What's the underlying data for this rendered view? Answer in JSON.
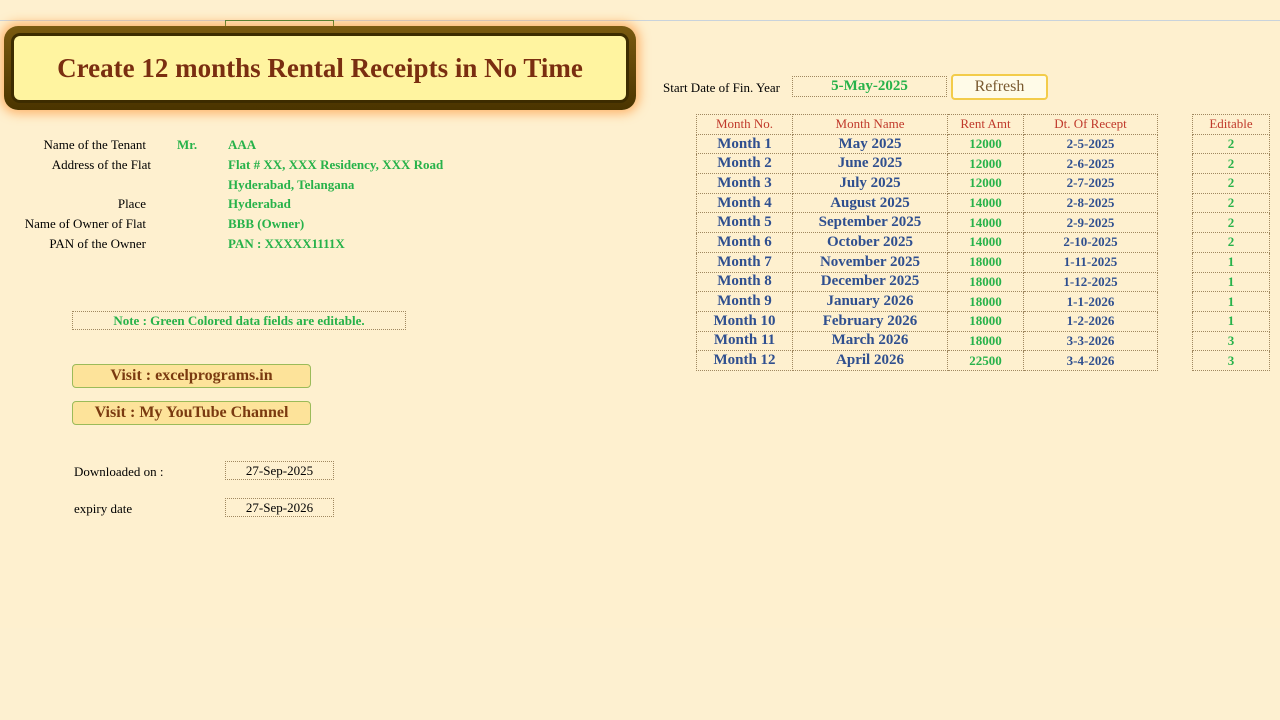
{
  "banner": {
    "title": "Create 12 months Rental Receipts in No Time"
  },
  "info": {
    "tenant_label": "Name of the Tenant",
    "tenant_salutation": "Mr.",
    "tenant_name": "AAA",
    "address_label": "Address of the Flat",
    "address_line1": "Flat # XX, XXX Residency, XXX Road",
    "address_line2": "Hyderabad, Telangana",
    "place_label": "Place",
    "place_value": "Hyderabad",
    "owner_label": "Name of Owner of Flat",
    "owner_value": "BBB (Owner)",
    "pan_label": "PAN of the Owner",
    "pan_value": "PAN : XXXXX1111X"
  },
  "note": "Note : Green Colored data fields are editable.",
  "links": {
    "site": "Visit : excelprograms.in",
    "youtube": "Visit : My YouTube Channel"
  },
  "download": {
    "downloaded_label": "Downloaded on :",
    "downloaded_value": "27-Sep-2025",
    "expiry_label": "expiry date",
    "expiry_value": "27-Sep-2026"
  },
  "start": {
    "label": "Start Date of Fin. Year",
    "value": "5-May-2025",
    "refresh_label": "Refresh"
  },
  "table": {
    "headers": [
      "Month No.",
      "Month Name",
      "Rent Amt",
      "Dt. Of Recept"
    ],
    "editable_header": "Editable",
    "rows": [
      {
        "no": "Month 1",
        "name": "May 2025",
        "rent": "12000",
        "date": "2-5-2025",
        "editable": "2"
      },
      {
        "no": "Month 2",
        "name": "June 2025",
        "rent": "12000",
        "date": "2-6-2025",
        "editable": "2"
      },
      {
        "no": "Month 3",
        "name": "July 2025",
        "rent": "12000",
        "date": "2-7-2025",
        "editable": "2"
      },
      {
        "no": "Month 4",
        "name": "August 2025",
        "rent": "14000",
        "date": "2-8-2025",
        "editable": "2"
      },
      {
        "no": "Month 5",
        "name": "September 2025",
        "rent": "14000",
        "date": "2-9-2025",
        "editable": "2"
      },
      {
        "no": "Month 6",
        "name": "October 2025",
        "rent": "14000",
        "date": "2-10-2025",
        "editable": "2"
      },
      {
        "no": "Month 7",
        "name": "November 2025",
        "rent": "18000",
        "date": "1-11-2025",
        "editable": "1"
      },
      {
        "no": "Month 8",
        "name": "December 2025",
        "rent": "18000",
        "date": "1-12-2025",
        "editable": "1"
      },
      {
        "no": "Month 9",
        "name": "January 2026",
        "rent": "18000",
        "date": "1-1-2026",
        "editable": "1"
      },
      {
        "no": "Month 10",
        "name": "February 2026",
        "rent": "18000",
        "date": "1-2-2026",
        "editable": "1"
      },
      {
        "no": "Month 11",
        "name": "March 2026",
        "rent": "18000",
        "date": "3-3-2026",
        "editable": "3"
      },
      {
        "no": "Month 12",
        "name": "April 2026",
        "rent": "22500",
        "date": "3-4-2026",
        "editable": "3"
      }
    ]
  },
  "colors": {
    "background": "#fef0cf",
    "editable_green": "#27b24a",
    "month_blue": "#2f4f8f",
    "header_red": "#c0392b",
    "banner_text": "#7a2e10"
  }
}
